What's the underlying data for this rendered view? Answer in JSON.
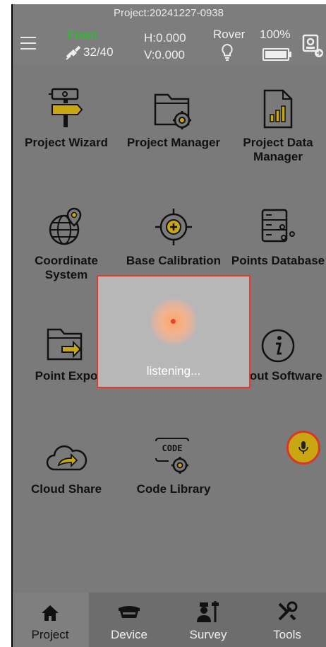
{
  "header": {
    "project": "Project:20241227-0938",
    "fix_status": "Fixed",
    "satellites": "32/40",
    "h_value": "H:0.000",
    "v_value": "V:0.000",
    "mode": "Rover",
    "battery": "100%"
  },
  "tiles": [
    {
      "id": "project-wizard",
      "label": "Project Wizard",
      "icon": "signpost-icon"
    },
    {
      "id": "project-manager",
      "label": "Project Manager",
      "icon": "folder-gear-icon"
    },
    {
      "id": "project-data-manager",
      "label": "Project Data Manager",
      "icon": "bar-chart-document-icon"
    },
    {
      "id": "coordinate-system",
      "label": "Coordinate System",
      "icon": "globe-pin-icon"
    },
    {
      "id": "base-calibration",
      "label": "Base Calibration",
      "icon": "target-plus-icon"
    },
    {
      "id": "points-database",
      "label": "Points Database",
      "icon": "database-points-icon"
    },
    {
      "id": "point-export",
      "label": "Point Expo",
      "icon": "folder-export-icon"
    },
    {
      "id": "about-software",
      "label": "About Software",
      "icon": "info-icon"
    },
    {
      "id": "cloud-share",
      "label": "Cloud Share",
      "icon": "cloud-share-icon"
    },
    {
      "id": "code-library",
      "label": "Code Library",
      "icon": "code-gear-icon"
    }
  ],
  "dialog": {
    "status": "listening..."
  },
  "nav": [
    {
      "label": "Project",
      "icon": "home-icon",
      "active": true
    },
    {
      "label": "Device",
      "icon": "receiver-icon"
    },
    {
      "label": "Survey",
      "icon": "surveyor-icon"
    },
    {
      "label": "Tools",
      "icon": "tools-icon"
    }
  ],
  "colors": {
    "accent": "#c9a711",
    "fix_green": "#1ec71e",
    "highlight_red": "#e53a2b"
  }
}
